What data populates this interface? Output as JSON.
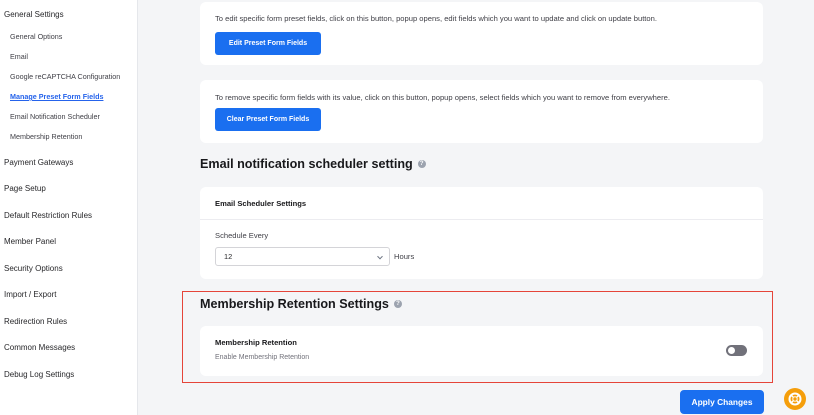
{
  "sidebar": {
    "general_settings": "General Settings",
    "sub_items": [
      "General Options",
      "Email",
      "Google reCAPTCHA Configuration",
      "Manage Preset Form Fields",
      "Email Notification Scheduler",
      "Membership Retention"
    ],
    "sections": [
      "Payment Gateways",
      "Page Setup",
      "Default Restriction Rules",
      "Member Panel",
      "Security Options",
      "Import / Export",
      "Redirection Rules",
      "Common Messages",
      "Debug Log Settings"
    ]
  },
  "edit_card": {
    "text": "To edit specific form preset fields, click on this button, popup opens, edit fields which you want to update and click on update button.",
    "button": "Edit Preset Form Fields"
  },
  "clear_card": {
    "text": "To remove specific form fields with its value, click on this button, popup opens, select fields which you want to remove from everywhere.",
    "button": "Clear Preset Form Fields"
  },
  "email_scheduler": {
    "heading": "Email notification scheduler setting",
    "card_title": "Email Scheduler Settings",
    "label": "Schedule Every",
    "value": "12",
    "unit": "Hours"
  },
  "membership_retention": {
    "heading": "Membership Retention Settings",
    "title": "Membership Retention",
    "description": "Enable Membership Retention",
    "enabled": false
  },
  "apply_button": "Apply Changes",
  "colors": {
    "accent": "#1a6ff0",
    "highlight": "#e5453a",
    "help_button": "#f59e0b"
  }
}
